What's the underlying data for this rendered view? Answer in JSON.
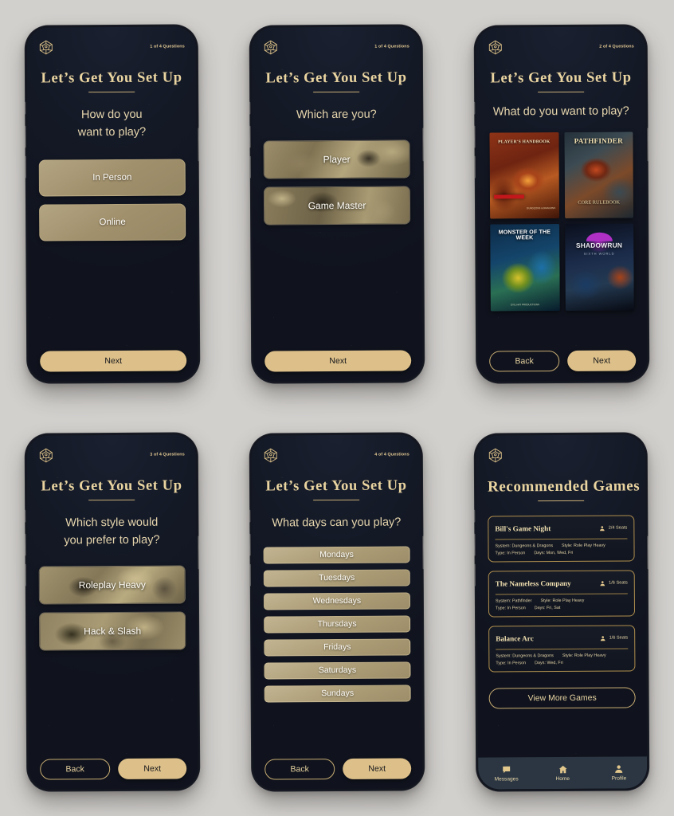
{
  "brand": {
    "logo_icon": "d20-dice-icon",
    "setup_title": "Let’s Get You  Set Up"
  },
  "screens": [
    {
      "id": "how-to-play",
      "progress": "1 of 4 Questions",
      "title": "Let’s Get You  Set Up",
      "question": "How do you\nwant to play?",
      "options": [
        "In Person",
        "Online"
      ],
      "footer": {
        "next": "Next"
      }
    },
    {
      "id": "which-are-you",
      "progress": "1 of 4 Questions",
      "title": "Let’s Get You  Set Up",
      "question": "Which are you?",
      "options": [
        "Player",
        "Game Master"
      ],
      "footer": {
        "next": "Next"
      }
    },
    {
      "id": "what-to-play",
      "progress": "2 of 4 Questions",
      "title": "Let’s Get You  Set Up",
      "question": "What do you want to play?",
      "covers": [
        {
          "title": "PLAYER'S HANDBOOK",
          "subtitle": "DUNGEONS & DRAGONS"
        },
        {
          "title": "PATHFINDER",
          "subtitle": "CORE RULEBOOK"
        },
        {
          "title": "MONSTER OF THE WEEK",
          "subtitle": "EVIL HAT PRODUCTIONS"
        },
        {
          "title": "SHADOWRUN",
          "subtitle": "SIXTH WORLD"
        }
      ],
      "footer": {
        "back": "Back",
        "next": "Next"
      }
    },
    {
      "id": "which-style",
      "progress": "3 of 4 Questions",
      "title": "Let’s Get You  Set Up",
      "question": "Which style would\nyou prefer to play?",
      "options": [
        "Roleplay Heavy",
        "Hack & Slash"
      ],
      "footer": {
        "back": "Back",
        "next": "Next"
      }
    },
    {
      "id": "what-days",
      "progress": "4 of 4 Questions",
      "title": "Let’s Get You  Set Up",
      "question": "What days can you play?",
      "options": [
        "Mondays",
        "Tuesdays",
        "Wednesdays",
        "Thursdays",
        "Fridays",
        "Saturdays",
        "Sundays"
      ],
      "footer": {
        "back": "Back",
        "next": "Next"
      }
    },
    {
      "id": "recommended-games",
      "title": "Recommended Games",
      "cards": [
        {
          "name": "Bill's Game Night",
          "seats": "2/4 Seats",
          "system_label": "System: Dungeons & Dragons",
          "style_label": "Style: Role Play Heavy",
          "type_label": "Type: In Person",
          "days_label": "Days: Mon, Wed, Fri"
        },
        {
          "name": "The Nameless Company",
          "seats": "1/6 Seats",
          "system_label": "System: Pathfinder",
          "style_label": "Style: Role Play Heavy",
          "type_label": "Type: In Person",
          "days_label": "Days: Fri, Sat"
        },
        {
          "name": "Balance Arc",
          "seats": "1/6 Seats",
          "system_label": "System: Dungeons & Dragons",
          "style_label": "Style: Role Play Heavy",
          "type_label": "Type: In Person",
          "days_label": "Days: Wed, Fri"
        }
      ],
      "view_more": "View More Games",
      "tabs": [
        {
          "label": "Messages",
          "icon": "message-icon"
        },
        {
          "label": "Home",
          "icon": "home-icon"
        },
        {
          "label": "Profile",
          "icon": "person-icon"
        }
      ]
    }
  ],
  "colors": {
    "page_background": "#d2d0cd",
    "screen_background": "#141926",
    "gold": "#ddc089",
    "gold_text": "#e9d4a0",
    "tan_option": "#a1906c",
    "tabbar": "#2b3642"
  }
}
